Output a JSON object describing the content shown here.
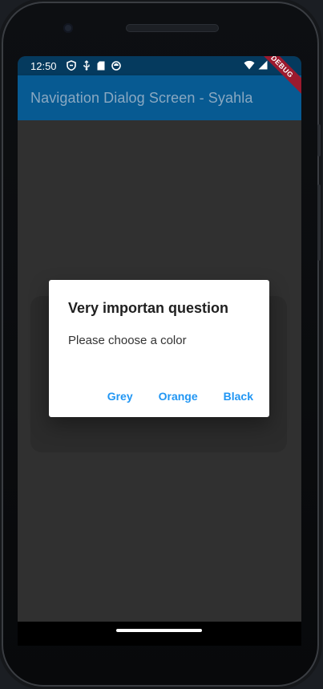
{
  "status_bar": {
    "time": "12:50",
    "left_icons": [
      "shield-icon",
      "usb-icon",
      "sd-card-icon",
      "data-saver-icon"
    ],
    "right_icons": [
      "wifi-icon",
      "cellular-signal-icon"
    ]
  },
  "app_bar": {
    "title": "Navigation Dialog Screen - Syahla",
    "color": "#075a92"
  },
  "debug_banner": {
    "label": "DEBUG"
  },
  "dialog": {
    "title": "Very importan question",
    "content": "Please choose a color",
    "actions": [
      {
        "label": "Grey"
      },
      {
        "label": "Orange"
      },
      {
        "label": "Black"
      }
    ],
    "accent": "#2196f3"
  }
}
